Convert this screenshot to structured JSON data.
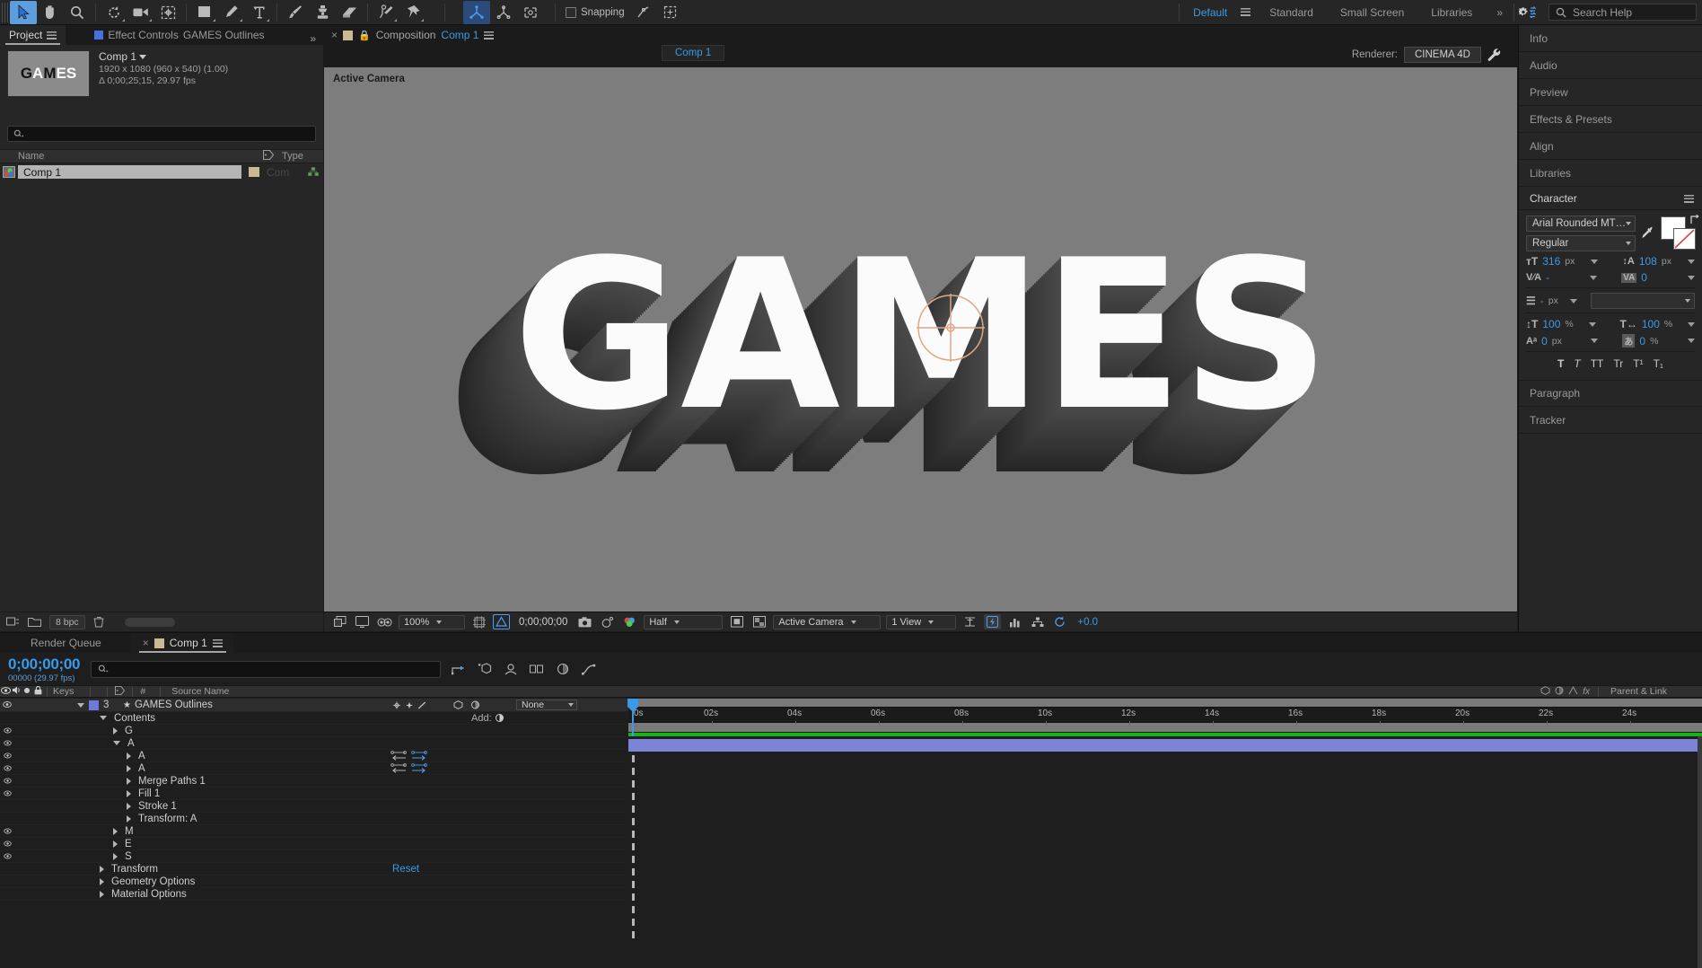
{
  "topbar": {
    "tools": [
      {
        "name": "selection-tool",
        "glyph": "arrow",
        "selected": true
      },
      {
        "name": "hand-tool",
        "glyph": "hand",
        "selected": false
      },
      {
        "name": "zoom-tool",
        "glyph": "magnifier",
        "selected": false
      },
      {
        "name": "rotation-tool",
        "glyph": "rotate",
        "selected": false
      },
      {
        "name": "camera-tool",
        "glyph": "camera",
        "selected": false
      },
      {
        "name": "pan-behind-tool",
        "glyph": "anchor-point",
        "selected": false
      },
      {
        "name": "shape-tool",
        "glyph": "rectangle",
        "selected": false
      },
      {
        "name": "pen-tool",
        "glyph": "pen",
        "selected": false
      },
      {
        "name": "type-tool",
        "glyph": "type",
        "selected": false
      },
      {
        "name": "brush-tool",
        "glyph": "brush",
        "selected": false
      },
      {
        "name": "clone-stamp-tool",
        "glyph": "stamp",
        "selected": false
      },
      {
        "name": "eraser-tool",
        "glyph": "eraser",
        "selected": false
      },
      {
        "name": "roto-brush-tool",
        "glyph": "roto-brush",
        "selected": false
      },
      {
        "name": "puppet-pin-tool",
        "glyph": "pin",
        "selected": false
      },
      {
        "name": "unified-camera-tool",
        "glyph": "axis-3d",
        "selected": true
      },
      {
        "name": "orbit-tool",
        "glyph": "orbit",
        "selected": false
      },
      {
        "name": "track-camera-tool",
        "glyph": "track-xy",
        "selected": false
      }
    ],
    "snapping_label": "Snapping",
    "workspaces": [
      {
        "label": "Default",
        "active": true
      },
      {
        "label": "Standard",
        "active": false
      },
      {
        "label": "Small Screen",
        "active": false
      },
      {
        "label": "Libraries",
        "active": false
      }
    ],
    "overflow_label": "»",
    "search_help_placeholder": "Search Help"
  },
  "project_panel": {
    "tabs": [
      {
        "label": "Project",
        "active": true
      },
      {
        "label": "Effect Controls",
        "secondary": "GAMES Outlines",
        "active": false
      }
    ],
    "selected_item": {
      "name": "Comp 1",
      "dimensions": "1920 x 1080  (960 x 540) (1.00)",
      "duration": "Δ 0;00;25;15, 29.97 fps",
      "thumbnail_text": "GAMES"
    },
    "search_placeholder": "",
    "columns": [
      "Name",
      "Type"
    ],
    "rows": [
      {
        "name": "Comp 1",
        "type": "Com",
        "label_color": "#cbb994"
      }
    ],
    "bit_depth": "8 bpc"
  },
  "composition_panel": {
    "tab_prefix": "Composition",
    "tab_name": "Comp 1",
    "sub_tab": "Comp 1",
    "renderer_label": "Renderer:",
    "renderer_value": "CINEMA 4D",
    "viewer_overlay": "Active Camera",
    "artwork_text": "GAMES",
    "bottom_bar": {
      "magnification": "100%",
      "timecode": "0;00;00;00",
      "resolution": "Half",
      "view_layout": "1 View",
      "camera": "Active Camera",
      "exposure": "+0.0"
    }
  },
  "right_panels": [
    {
      "label": "Info",
      "expanded": false
    },
    {
      "label": "Audio",
      "expanded": false
    },
    {
      "label": "Preview",
      "expanded": false
    },
    {
      "label": "Effects & Presets",
      "expanded": false
    },
    {
      "label": "Align",
      "expanded": false
    },
    {
      "label": "Libraries",
      "expanded": false
    },
    {
      "label": "Character",
      "expanded": true
    },
    {
      "label": "Paragraph",
      "expanded": false
    },
    {
      "label": "Tracker",
      "expanded": false
    }
  ],
  "character_panel": {
    "font_family": "Arial Rounded MT…",
    "font_style": "Regular",
    "font_size": "316",
    "font_size_unit": "px",
    "leading": "108",
    "leading_unit": "px",
    "kerning": "-",
    "tracking": "0",
    "stroke_width": "-",
    "stroke_width_unit": "px",
    "stroke_style": "",
    "vertical_scale": "100",
    "vertical_scale_unit": "%",
    "horizontal_scale": "100",
    "horizontal_scale_unit": "%",
    "baseline_shift": "0",
    "baseline_shift_unit": "px",
    "tsume": "0",
    "tsume_unit": "%",
    "fill_color": "#ffffff",
    "stroke_color": "#ffffff",
    "style_buttons": [
      "T",
      "T",
      "TT",
      "Tr",
      "T¹",
      "T₁"
    ]
  },
  "timeline_panel": {
    "tabs": [
      {
        "label": "Render Queue",
        "active": false
      },
      {
        "label": "Comp 1",
        "active": true
      }
    ],
    "current_time": "0;00;00;00",
    "frame_info": "00000 (29.97 fps)",
    "search_placeholder": "",
    "column_headers": [
      "Keys",
      "#",
      "Source Name",
      "Parent & Link"
    ],
    "add_label": "Add:",
    "reset_label": "Reset",
    "parent_value": "None",
    "layers": [
      {
        "index": "3",
        "name": "GAMES Outlines",
        "indent": 0,
        "expanded": true,
        "eye": true,
        "selected": true,
        "star": true,
        "type": "layer"
      },
      {
        "name": "Contents",
        "indent": 1,
        "expanded": true,
        "eye": false,
        "type": "group",
        "add": true
      },
      {
        "name": "G",
        "indent": 2,
        "expanded": false,
        "eye": true,
        "type": "group"
      },
      {
        "name": "A",
        "indent": 2,
        "expanded": true,
        "eye": true,
        "type": "group"
      },
      {
        "name": "A",
        "indent": 3,
        "expanded": false,
        "eye": true,
        "type": "path",
        "pathicons": true
      },
      {
        "name": "A",
        "indent": 3,
        "expanded": false,
        "eye": true,
        "type": "path",
        "pathicons": true
      },
      {
        "name": "Merge Paths 1",
        "indent": 3,
        "expanded": false,
        "eye": true,
        "type": "prop"
      },
      {
        "name": "Fill 1",
        "indent": 3,
        "expanded": false,
        "eye": true,
        "type": "prop"
      },
      {
        "name": "Stroke 1",
        "indent": 3,
        "expanded": false,
        "eye": false,
        "type": "prop"
      },
      {
        "name": "Transform: A",
        "indent": 3,
        "expanded": false,
        "eye": false,
        "type": "prop"
      },
      {
        "name": "M",
        "indent": 2,
        "expanded": false,
        "eye": true,
        "type": "group"
      },
      {
        "name": "E",
        "indent": 2,
        "expanded": false,
        "eye": true,
        "type": "group"
      },
      {
        "name": "S",
        "indent": 2,
        "expanded": false,
        "eye": true,
        "type": "group"
      },
      {
        "name": "Transform",
        "indent": 1,
        "expanded": false,
        "eye": false,
        "type": "prop",
        "reset": true
      },
      {
        "name": "Geometry Options",
        "indent": 1,
        "expanded": false,
        "eye": false,
        "type": "prop"
      },
      {
        "name": "Material Options",
        "indent": 1,
        "expanded": false,
        "eye": false,
        "type": "prop"
      }
    ],
    "ruler_ticks": [
      "0s",
      "02s",
      "04s",
      "06s",
      "08s",
      "10s",
      "12s",
      "14s",
      "16s",
      "18s",
      "20s",
      "22s",
      "24s"
    ],
    "work_area_color": "#19b219",
    "layer_bar_color": "#7b84d6",
    "playhead_color": "#3a9ae8"
  },
  "colors": {
    "accent_blue": "#3a9ae8",
    "panel_bg": "#262626",
    "app_bg": "#1b1b1b",
    "viewer_bg": "#7d7d7d",
    "text": "#c8c8c8"
  }
}
